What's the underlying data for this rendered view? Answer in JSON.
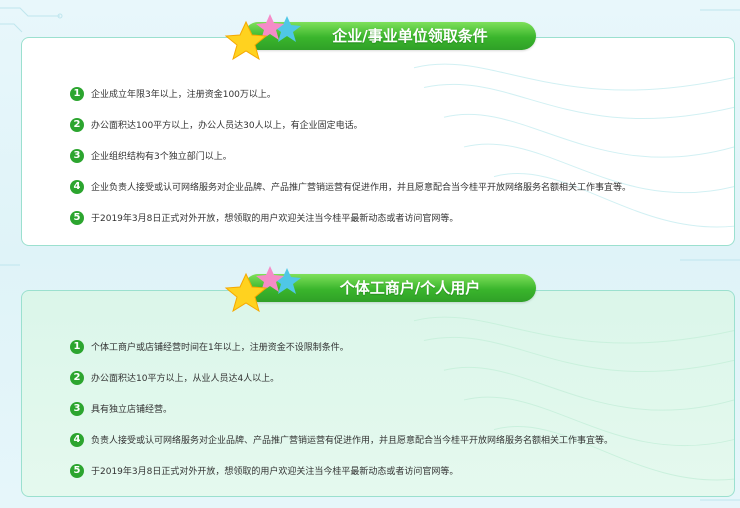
{
  "sections": [
    {
      "title": "企业/事业单位领取条件",
      "items": [
        "企业成立年限3年以上，注册资金100万以上。",
        "办公面积达100平方以上，办公人员达30人以上，有企业固定电话。",
        "企业组织结构有3个独立部门以上。",
        "企业负责人接受或认可网络服务对企业品牌、产品推广营销运营有促进作用，并且愿意配合当今桂平开放网络服务名额相关工作事宜等。",
        "于2019年3月8日正式对外开放，想领取的用户欢迎关注当今桂平最新动态或者访问官网等。"
      ]
    },
    {
      "title": "个体工商户/个人用户",
      "items": [
        "个体工商户或店铺经营时间在1年以上，注册资金不设限制条件。",
        "办公面积达10平方以上，从业人员达4人以上。",
        "具有独立店铺经营。",
        "负责人接受或认可网络服务对企业品牌、产品推广营销运营有促进作用，并且愿意配合当今桂平开放网络服务名额相关工作事宜等。",
        "于2019年3月8日正式对外开放，想领取的用户欢迎关注当今桂平最新动态或者访问官网等。"
      ]
    }
  ],
  "numbers": [
    "1",
    "2",
    "3",
    "4",
    "5"
  ],
  "colors": {
    "accent": "#2ca52f",
    "border": "#9be0cf",
    "panel2_bg": "#dbf6ea"
  },
  "icons": {
    "banner_decor": "stars-icon"
  }
}
